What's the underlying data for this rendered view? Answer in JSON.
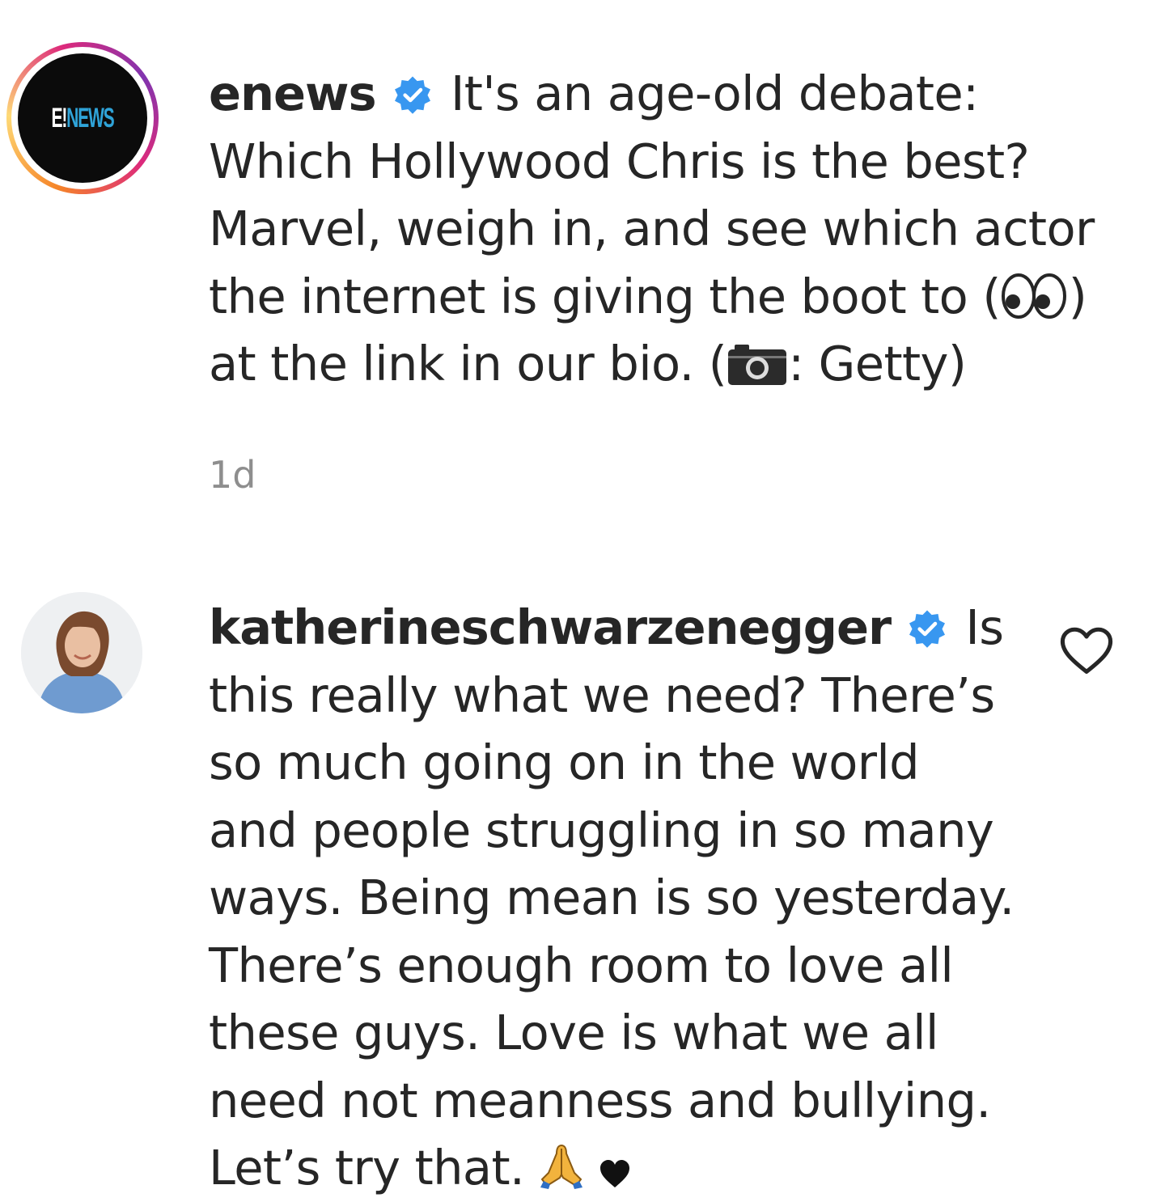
{
  "caption": {
    "username": "enews",
    "avatar_logo_left": "E!",
    "avatar_logo_right": "NEWS",
    "lines": [
      "It's an age-old debate:",
      "Which Hollywood Chris is the best?",
      "Marvel, weigh in, and see which actor",
      "the internet is giving the boot to (",
      ")",
      "at the link in our bio. (",
      ": Getty)"
    ],
    "timestamp": "1d",
    "emoji_icons": [
      "eyes-emoji",
      "camera-emoji"
    ]
  },
  "comment": {
    "username": "katherineschwarzenegger",
    "lines": [
      "Is",
      "this really what we need? There’s",
      "so much going on in the world",
      "and people struggling in so many",
      "ways. Being mean is so yesterday.",
      "There’s enough room to love all",
      "these guys. Love is what we all",
      "need not meanness and bullying.",
      "Let’s try that."
    ],
    "emoji_icons": [
      "folded-hands-emoji",
      "heart-emoji"
    ],
    "like_icon": "heart-outline-icon"
  },
  "colors": {
    "verified_blue": "#3897f0",
    "text": "#262626",
    "muted": "#8e8e8e",
    "logo_news": "#2fa3d8"
  }
}
